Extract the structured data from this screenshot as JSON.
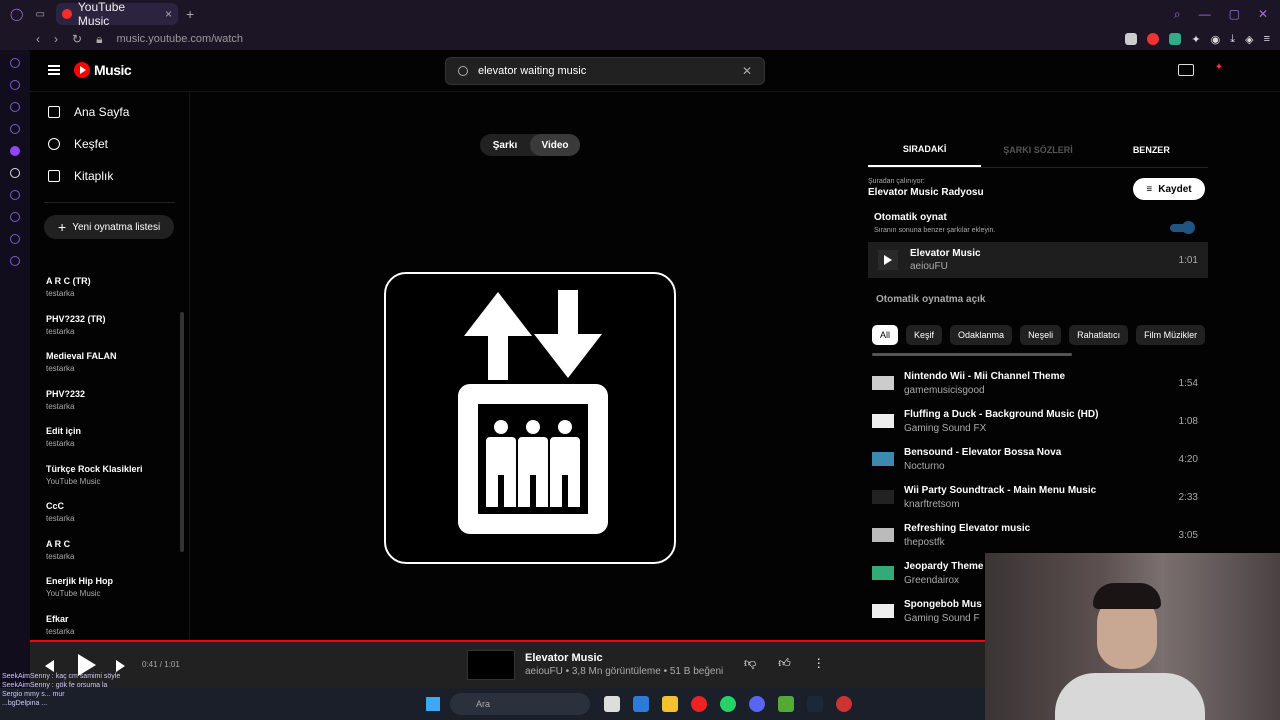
{
  "browser": {
    "tab_title": "YouTube Music",
    "address": "music.youtube.com/watch"
  },
  "header": {
    "logo_text": "Music",
    "search_value": "elevator waiting music"
  },
  "sidebar": {
    "nav": [
      {
        "label": "Ana Sayfa"
      },
      {
        "label": "Keşfet"
      },
      {
        "label": "Kitaplık"
      }
    ],
    "new_playlist": "Yeni oynatma listesi",
    "playlists": [
      {
        "name": "A R C (TR)",
        "owner": "testarka"
      },
      {
        "name": "PHV?232 (TR)",
        "owner": "testarka"
      },
      {
        "name": "Medieval FALAN",
        "owner": "testarka"
      },
      {
        "name": "PHV?232",
        "owner": "testarka"
      },
      {
        "name": "Edit için",
        "owner": "testarka"
      },
      {
        "name": "Türkçe Rock Klasikleri",
        "owner": "YouTube Music"
      },
      {
        "name": "CcC",
        "owner": "testarka"
      },
      {
        "name": "A R C",
        "owner": "testarka"
      },
      {
        "name": "Enerjik Hip Hop",
        "owner": "YouTube Music"
      },
      {
        "name": "Efkar",
        "owner": "testarka"
      }
    ]
  },
  "toggle": {
    "song": "Şarkı",
    "video": "Video"
  },
  "right": {
    "tabs": [
      "SIRADAKİ",
      "ŞARKI SÖZLERİ",
      "BENZER"
    ],
    "playing_from_label": "Şuradan çalınıyor:",
    "playing_from": "Elevator Music Radyosu",
    "save": "Kaydet",
    "autoplay_title": "Otomatik oynat",
    "autoplay_sub": "Sıranın sonuna benzer şarkılar ekleyin.",
    "current": {
      "title": "Elevator Music",
      "artist": "aeiouFU",
      "duration": "1:01"
    },
    "autoplay_on": "Otomatik oynatma açık",
    "chips": [
      "All",
      "Keşif",
      "Odaklanma",
      "Neşeli",
      "Rahatlatıcı",
      "Film Müzikler"
    ],
    "queue": [
      {
        "title": "Nintendo Wii - Mii Channel Theme",
        "artist": "gamemusicisgood",
        "duration": "1:54"
      },
      {
        "title": "Fluffing a Duck - Background Music (HD)",
        "artist": "Gaming Sound FX",
        "duration": "1:08"
      },
      {
        "title": "Bensound - Elevator Bossa Nova",
        "artist": "Nocturno",
        "duration": "4:20"
      },
      {
        "title": "Wii Party Soundtrack - Main Menu Music",
        "artist": "knarftretsom",
        "duration": "2:33"
      },
      {
        "title": "Refreshing Elevator music",
        "artist": "thepostfk",
        "duration": "3:05"
      },
      {
        "title": "Jeopardy Theme",
        "artist": "Greendairox",
        "duration": ""
      },
      {
        "title": "Spongebob Mus",
        "artist": "Gaming Sound F",
        "duration": ""
      }
    ]
  },
  "player": {
    "time": "0:41 / 1:01",
    "title": "Elevator Music",
    "meta": "aeiouFU • 3,8 Mn görüntüleme • 51 B beğeni"
  },
  "taskbar": {
    "search": "Ara"
  },
  "chat": [
    "SeekAimSenny : kaç cm samimi söyle",
    "SeekAimSenny : gök fe orsuma la",
    "Sergio mmy s... mur",
    "...bgDelpina ..."
  ]
}
